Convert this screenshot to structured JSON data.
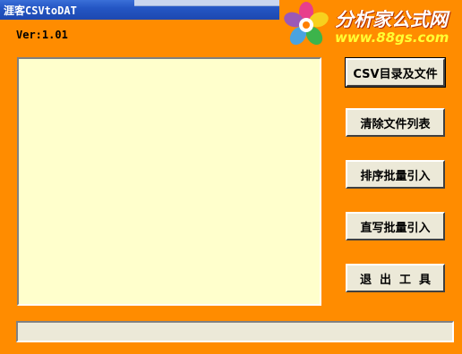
{
  "window": {
    "title": "涯客CSVtoDAT",
    "version": "Ver:1.01"
  },
  "logo": {
    "name": "分析家公式网",
    "url": "www.88gs.com"
  },
  "file_list": {
    "items": []
  },
  "buttons": {
    "csv_dir": "CSV目录及文件",
    "clear_list": "清除文件列表",
    "sort_batch_import": "排序批量引入",
    "direct_batch_import": "直写批量引入",
    "exit_tool": "退出工具"
  },
  "status_bar": {
    "text": ""
  },
  "colors": {
    "window_background": "#ff8c00",
    "file_list_background": "#ffffcc",
    "button_face": "#ece9d8",
    "titlebar": "#2456c4"
  }
}
